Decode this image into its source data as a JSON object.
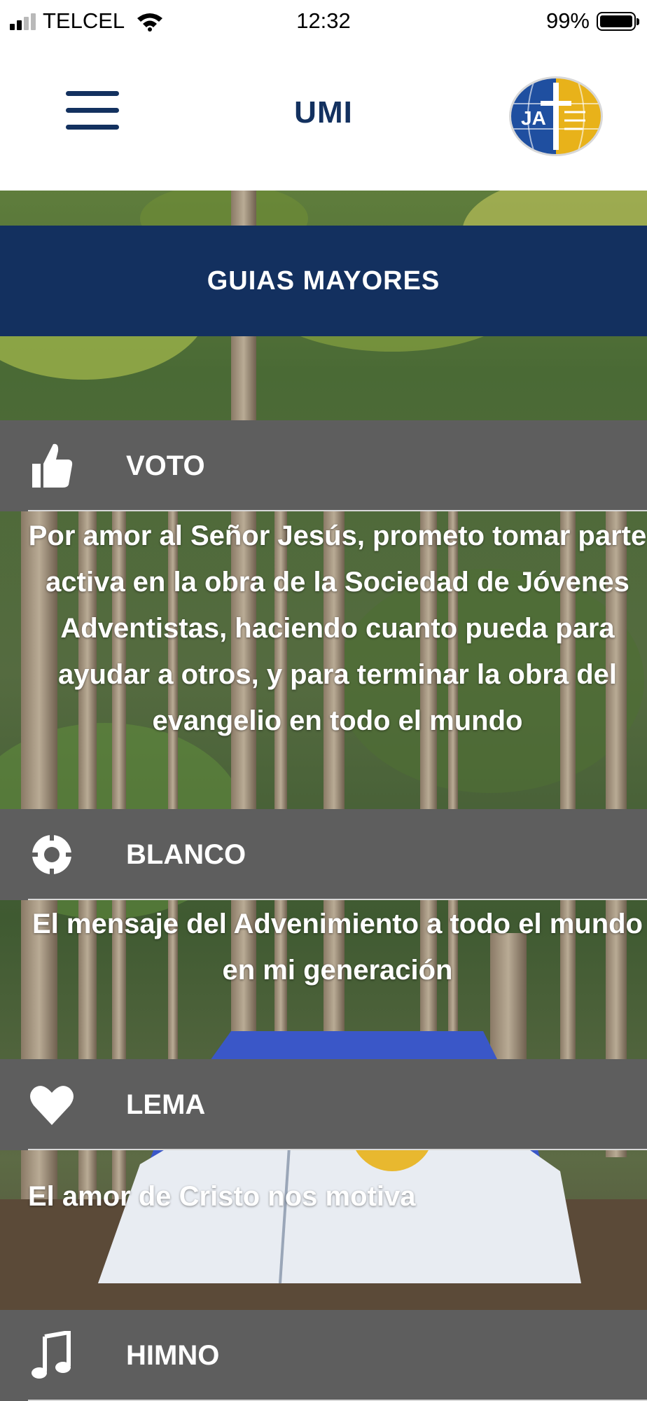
{
  "status_bar": {
    "carrier": "TELCEL",
    "time": "12:32",
    "battery": "99%",
    "battery_level": 0.99
  },
  "nav": {
    "title": "UMI",
    "logo_text": "JA",
    "logo_colors": {
      "left": "#1f4fa0",
      "right": "#e8b21a"
    }
  },
  "header": {
    "title": "GUIAS MAYORES"
  },
  "sections": [
    {
      "icon": "thumbs-up-icon",
      "label": "VOTO",
      "text": "Por amor al Señor Jesús, prometo tomar parte activa en la obra de la Sociedad de Jóvenes Adventistas, haciendo cuanto pueda para ayudar a otros, y para terminar la obra del evangelio en todo el mundo"
    },
    {
      "icon": "target-icon",
      "label": "BLANCO",
      "text": "El mensaje del Advenimiento a todo el mundo en mi generación"
    },
    {
      "icon": "heart-icon",
      "label": "LEMA",
      "text": "El amor de Cristo nos motiva"
    },
    {
      "icon": "music-note-icon",
      "label": "HIMNO"
    }
  ],
  "colors": {
    "brand_navy": "#13305f",
    "row_gray": "#5e5e5e",
    "text_white": "#ffffff"
  }
}
